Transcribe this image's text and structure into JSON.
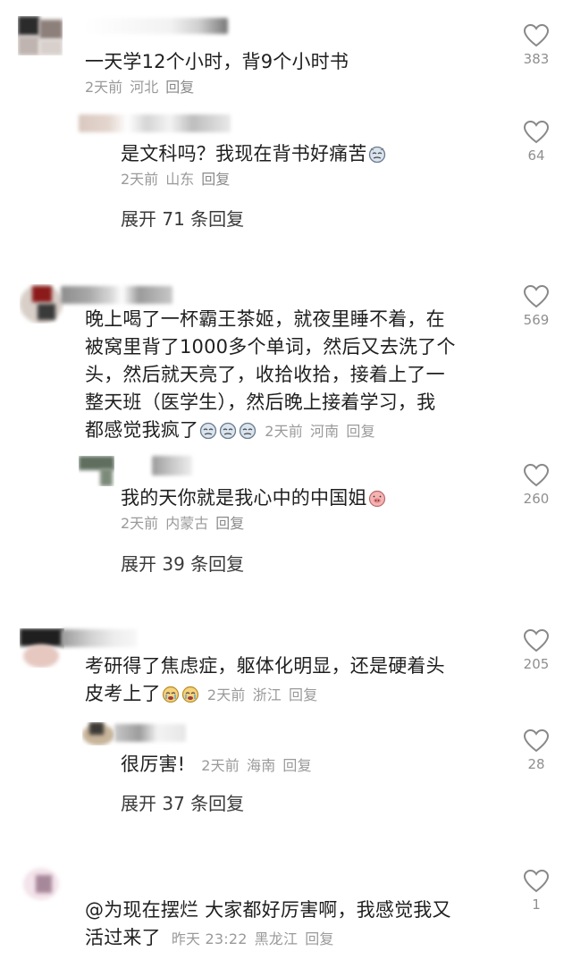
{
  "comments": [
    {
      "text": "一天学12个小时，背9个小时书",
      "date": "2天前",
      "location": "河北",
      "reply": "回复",
      "likes": "383",
      "replies": [
        {
          "text": "是文科吗？我现在背书好痛苦",
          "date": "2天前",
          "location": "山东",
          "reply": "回复",
          "likes": "64"
        }
      ],
      "expand": "展开 71 条回复"
    },
    {
      "text_lines": [
        "晚上喝了一杯霸王茶姬，就夜里睡不着，在",
        "被窝里背了1000多个单词，然后又去洗了个",
        "头，然后就天亮了，收拾收拾，接着上了一",
        "整天班（医学生），然后晚上接着学习，我",
        "都感觉我疯了"
      ],
      "date": "2天前",
      "location": "河南",
      "reply": "回复",
      "likes": "569",
      "replies": [
        {
          "text": "我的天你就是我心中的中国姐",
          "date": "2天前",
          "location": "内蒙古",
          "reply": "回复",
          "likes": "260"
        }
      ],
      "expand": "展开 39 条回复"
    },
    {
      "text_lines": [
        "考研得了焦虑症，躯体化明显，还是硬着头",
        "皮考上了"
      ],
      "date": "2天前",
      "location": "浙江",
      "reply": "回复",
      "likes": "205",
      "replies": [
        {
          "text": "很厉害!",
          "date": "2天前",
          "location": "海南",
          "reply": "回复",
          "likes": "28"
        }
      ],
      "expand": "展开 37 条回复"
    },
    {
      "text_lines": [
        "@为现在摆烂  大家都好厉害啊，我感觉我又",
        "活过来了"
      ],
      "date": "昨天 23:22",
      "location": "黑龙江",
      "reply": "回复",
      "likes": "1"
    }
  ]
}
